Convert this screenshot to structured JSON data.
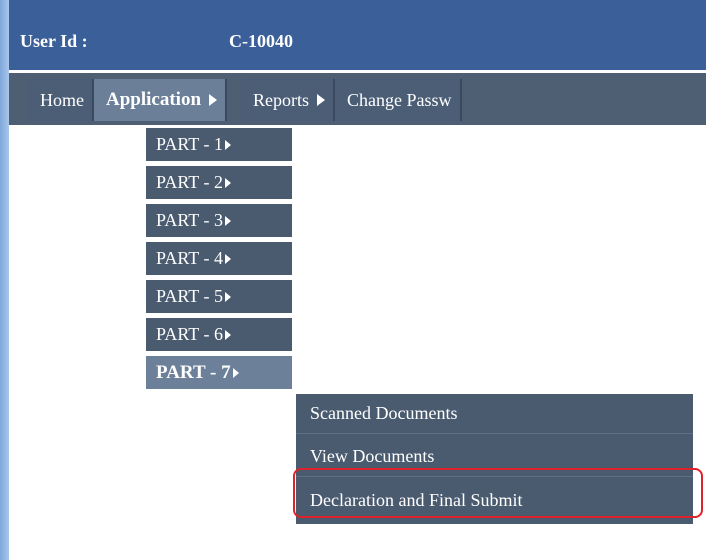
{
  "header": {
    "user_id_label": "User Id :",
    "user_id_value": "C-10040"
  },
  "nav": [
    {
      "label": "Home",
      "has_arrow": false,
      "active": false
    },
    {
      "label": "Application",
      "has_arrow": true,
      "active": true
    },
    {
      "label": "Reports",
      "has_arrow": true,
      "active": false
    },
    {
      "label": "Change Passw",
      "has_arrow": false,
      "active": false
    }
  ],
  "application_menu": [
    {
      "label": "PART - 1"
    },
    {
      "label": "PART - 2"
    },
    {
      "label": "PART - 3"
    },
    {
      "label": "PART - 4"
    },
    {
      "label": "PART - 5"
    },
    {
      "label": "PART - 6"
    },
    {
      "label": "PART - 7"
    }
  ],
  "part7_menu": [
    {
      "label": "Scanned Documents"
    },
    {
      "label": "View Documents"
    },
    {
      "label": "Declaration and Final Submit"
    }
  ],
  "colors": {
    "header_bg": "#3b5f99",
    "menu_bg": "#4a5b70",
    "menu_active_bg": "#6d809a",
    "highlight_border": "#e0222a"
  }
}
